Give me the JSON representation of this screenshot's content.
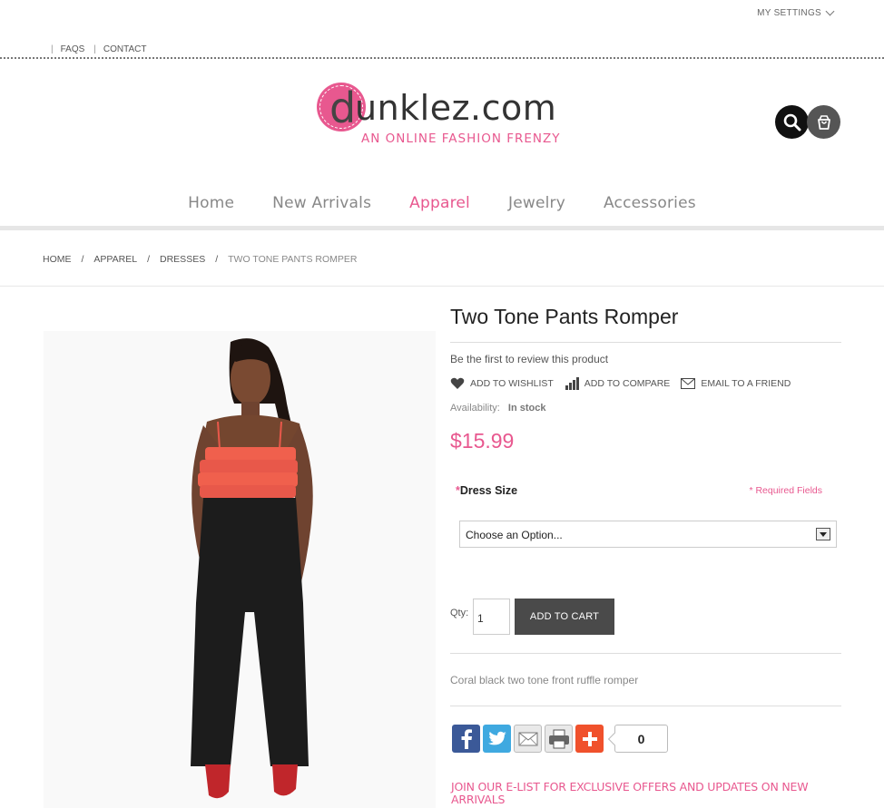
{
  "topbar": {
    "settings_label": "MY SETTINGS",
    "links": [
      "FAQS",
      "CONTACT"
    ]
  },
  "logo": {
    "d_letter": "d",
    "word": "unklez.com",
    "tagline": "AN ONLINE FASHION FRENZY"
  },
  "header_icons": [
    "search-icon",
    "shopping-bag-icon"
  ],
  "nav": {
    "items": [
      "Home",
      "New Arrivals",
      "Apparel",
      "Jewelry",
      "Accessories"
    ],
    "active": "Apparel"
  },
  "breadcrumb": [
    "HOME",
    "APPAREL",
    "DRESSES",
    "TWO TONE PANTS ROMPER"
  ],
  "product": {
    "title": "Two Tone Pants Romper",
    "review_text": "Be the first to review this product",
    "actions": [
      "ADD TO WISHLIST",
      "ADD TO COMPARE",
      "EMAIL TO A FRIEND"
    ],
    "availability_label": "Availability:",
    "availability_value": "In stock",
    "price": "$15.99",
    "option_label": "Dress Size",
    "required_note": "* Required Fields",
    "select_value": "Choose an Option...",
    "qty_label": "Qty:",
    "qty_value": "1",
    "add_to_cart": "ADD TO CART",
    "description": "Coral black two tone front ruffle romper"
  },
  "share": {
    "buttons": [
      "facebook-icon",
      "twitter-icon",
      "mail-icon",
      "print-icon",
      "addthis-plus-icon"
    ],
    "count": "0"
  },
  "elist_text": "JOIN OUR E-LIST FOR EXCLUSIVE OFFERS AND UPDATES ON NEW ARRIVALS",
  "colors": {
    "brand_pink": "#e8588f",
    "button_dark": "#4a4a4a",
    "facebook": "#3b5998",
    "twitter": "#3fa9e0",
    "addthis": "#f0512c"
  }
}
